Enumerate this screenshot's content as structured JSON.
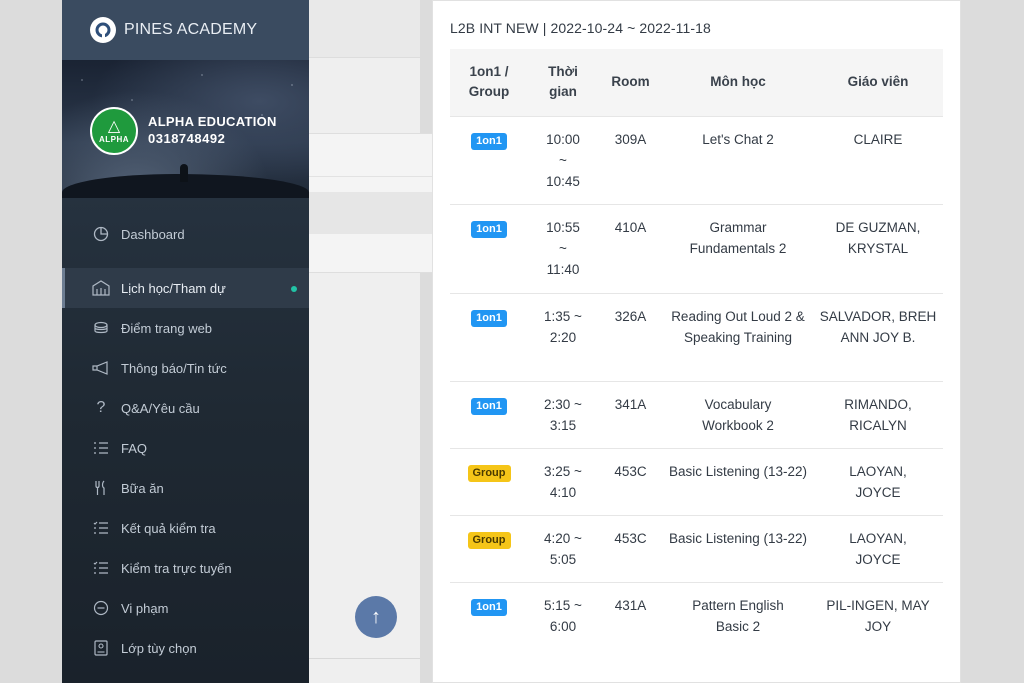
{
  "brand": {
    "name": "PINES ACADEMY",
    "logo_icon": "pines-logo-icon"
  },
  "profile": {
    "org_name": "ALPHA EDUCATION",
    "phone": "0318748492",
    "avatar_text": "ALPHA"
  },
  "menu": [
    {
      "label": "Dashboard",
      "icon": "dashboard-icon",
      "active": false
    },
    {
      "label": "Lịch học/Tham dự",
      "icon": "building-icon",
      "active": true
    },
    {
      "label": "Điểm trang web",
      "icon": "coins-icon",
      "active": false
    },
    {
      "label": "Thông báo/Tin tức",
      "icon": "megaphone-icon",
      "active": false
    },
    {
      "label": "Q&A/Yêu cầu",
      "icon": "question-icon",
      "active": false
    },
    {
      "label": "FAQ",
      "icon": "list-icon",
      "active": false
    },
    {
      "label": "Bữa ăn",
      "icon": "utensils-icon",
      "active": false
    },
    {
      "label": "Kết quả kiểm tra",
      "icon": "checklist-icon",
      "active": false
    },
    {
      "label": "Kiểm tra trực tuyến",
      "icon": "checklist-icon",
      "active": false
    },
    {
      "label": "Vi phạm",
      "icon": "minus-circle-icon",
      "active": false
    },
    {
      "label": "Lớp tùy chọn",
      "icon": "id-card-icon",
      "active": false
    }
  ],
  "schedule": {
    "title": "L2B INT NEW | 2022-10-24 ~ 2022-11-18",
    "headers": {
      "type": "1on1 / Group",
      "time": "Thời gian",
      "room": "Room",
      "subject": "Môn học",
      "teacher": "Giáo viên"
    },
    "rows": [
      {
        "type": "1on1",
        "time": "10:00 ~ 10:45",
        "room": "309A",
        "subject": "Let's Chat 2",
        "teacher": "CLAIRE"
      },
      {
        "type": "1on1",
        "time": "10:55 ~ 11:40",
        "room": "410A",
        "subject": "Grammar Fundamentals 2",
        "teacher": "DE GUZMAN, KRYSTAL"
      },
      {
        "type": "1on1",
        "time": "1:35 ~ 2:20",
        "room": "326A",
        "subject": "Reading Out Loud 2 & Speaking Training",
        "teacher": "SALVADOR, BREH ANN JOY B."
      },
      {
        "type": "1on1",
        "time": "2:30 ~ 3:15",
        "room": "341A",
        "subject": "Vocabulary Workbook 2",
        "teacher": "RIMANDO, RICALYN"
      },
      {
        "type": "Group",
        "time": "3:25 ~ 4:10",
        "room": "453C",
        "subject": "Basic Listening (13-22)",
        "teacher": "LAOYAN, JOYCE"
      },
      {
        "type": "Group",
        "time": "4:20 ~ 5:05",
        "room": "453C",
        "subject": "Basic Listening (13-22)",
        "teacher": "LAOYAN, JOYCE"
      },
      {
        "type": "1on1",
        "time": "5:15 ~ 6:00",
        "room": "431A",
        "subject": "Pattern English Basic 2",
        "teacher": "PIL-INGEN, MAY JOY"
      }
    ]
  },
  "scroll_top": {
    "icon": "arrow-up-icon",
    "glyph": "↑"
  },
  "colors": {
    "badge_1on1": "#2196f3",
    "badge_group": "#f5c518",
    "active_dot": "#22c3a6"
  }
}
